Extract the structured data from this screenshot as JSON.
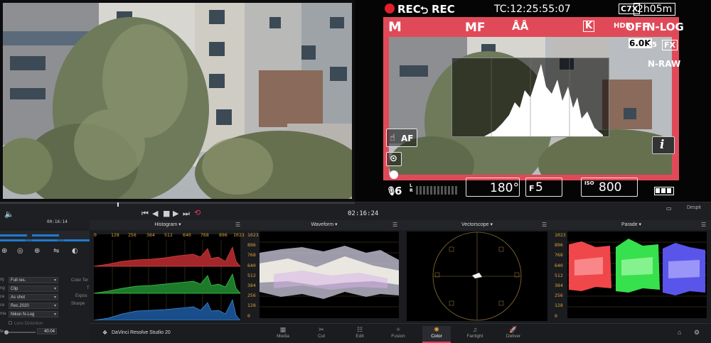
{
  "camera": {
    "rec_label": "REC",
    "rec2_label": "REC",
    "timecode": "TC:12:25:55:07",
    "battery_time": "2h05m",
    "mode": "M",
    "focus_mode": "MF",
    "picture_style": "K",
    "hdr_off": "OFF",
    "log": "N-LOG",
    "resolution": "6.0K",
    "fps": "25",
    "fx_label": "FX",
    "codec": "N-RAW",
    "af_label": "AF",
    "shutter": "180°",
    "aperture_prefix": "F",
    "aperture": "5",
    "iso_prefix": "ISO",
    "iso": "800",
    "mic_level": "6",
    "mic_lr": "L R",
    "info_label": "i"
  },
  "transport": {
    "timecode": "02:16:24",
    "right_label": "Despit"
  },
  "left_panel": {
    "field_value": "00:16:14",
    "rows": [
      {
        "label": "ity",
        "value": "Full res."
      },
      {
        "label": "ng",
        "value": "Clip"
      },
      {
        "label": "ce",
        "value": "As shot"
      },
      {
        "label": "ce",
        "value": "Rec.2020"
      },
      {
        "label": "ma",
        "value": "Nikon N-Log"
      }
    ],
    "lens_distortion": "Lens Distortion",
    "slider_label": "te",
    "slider_value": "40.04",
    "side_labels": [
      "Color Ter",
      "T",
      "Expos",
      "Sharpe"
    ]
  },
  "scopes": {
    "histogram": {
      "title": "Histogram",
      "x_ticks": [
        "0",
        "128",
        "256",
        "384",
        "512",
        "640",
        "768",
        "896",
        "1023"
      ]
    },
    "waveform": {
      "title": "Waveform",
      "y_ticks": [
        "1023",
        "896",
        "768",
        "640",
        "512",
        "384",
        "256",
        "128",
        "0"
      ]
    },
    "vectorscope": {
      "title": "Vectorscope"
    },
    "parade": {
      "title": "Parade",
      "y_ticks": [
        "1023",
        "896",
        "768",
        "640",
        "512",
        "384",
        "256",
        "128",
        "0"
      ]
    }
  },
  "app": {
    "name": "DaVinci Resolve Studio 20"
  },
  "nav": [
    {
      "label": "Media",
      "icon": "media-icon"
    },
    {
      "label": "Cut",
      "icon": "cut-icon"
    },
    {
      "label": "Edit",
      "icon": "edit-icon"
    },
    {
      "label": "Fusion",
      "icon": "fusion-icon"
    },
    {
      "label": "Color",
      "icon": "color-icon"
    },
    {
      "label": "Fairlight",
      "icon": "fairlight-icon"
    },
    {
      "label": "Deliver",
      "icon": "deliver-icon"
    }
  ],
  "colors": {
    "accent": "#e8365a",
    "scope_label": "#d7a23a",
    "rec_red": "#e0202a"
  }
}
